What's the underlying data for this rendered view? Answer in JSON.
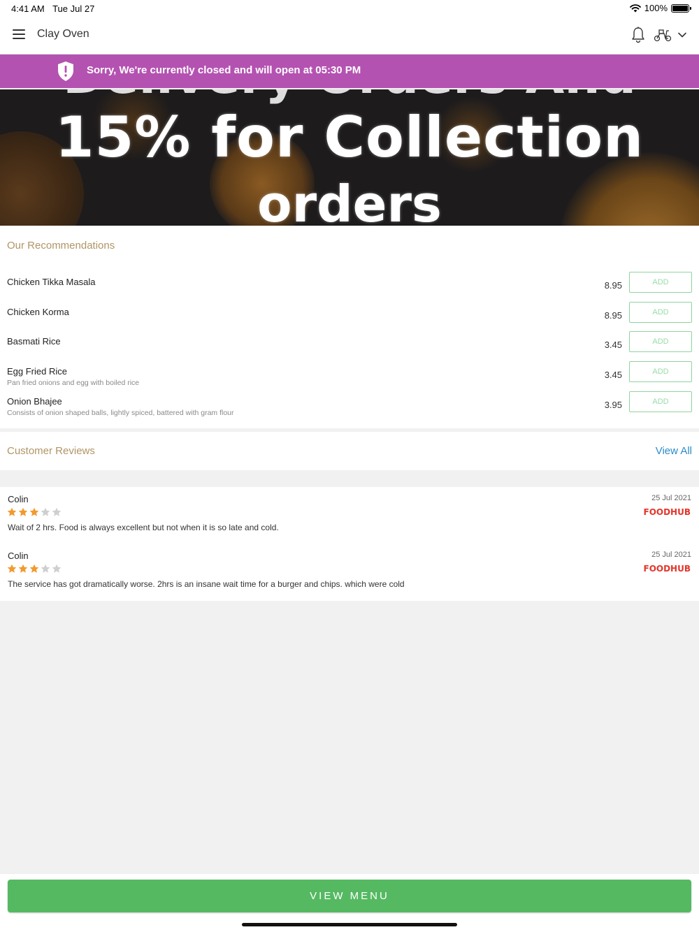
{
  "status_bar": {
    "time": "4:41 AM",
    "date": "Tue Jul 27",
    "battery": "100%"
  },
  "header": {
    "title": "Clay Oven"
  },
  "closed_banner": {
    "text": "Sorry, We're currently closed and will open at 05:30 PM",
    "color": "#b452b1"
  },
  "promo": {
    "line_top": "Delivery Orders And",
    "line1": "15% for Collection",
    "line2": "orders"
  },
  "recommendations": {
    "title": "Our Recommendations",
    "add_label": "ADD",
    "items": [
      {
        "name": "Chicken Tikka Masala",
        "desc": "",
        "price": "8.95"
      },
      {
        "name": "Chicken Korma",
        "desc": "",
        "price": "8.95"
      },
      {
        "name": "Basmati Rice",
        "desc": "",
        "price": "3.45"
      },
      {
        "name": "Egg Fried Rice",
        "desc": "Pan fried onions and egg with boiled rice",
        "price": "3.45"
      },
      {
        "name": "Onion Bhajee",
        "desc": "Consists of onion shaped balls, lightly spiced, battered with gram flour",
        "price": "3.95"
      }
    ]
  },
  "reviews": {
    "title": "Customer Reviews",
    "view_all": "View All",
    "items": [
      {
        "name": "Colin",
        "rating": 3,
        "date": "25 Jul 2021",
        "source": "FOODHUB",
        "text": "Wait of 2 hrs. Food is always excellent but not when it is so late and cold."
      },
      {
        "name": "Colin",
        "rating": 3,
        "date": "25 Jul 2021",
        "source": "FOODHUB",
        "text": "The service has got dramatically worse. 2hrs is an insane wait time for a burger and chips. which were cold"
      }
    ]
  },
  "footer": {
    "view_menu": "VIEW MENU",
    "button_color": "#55b962"
  }
}
